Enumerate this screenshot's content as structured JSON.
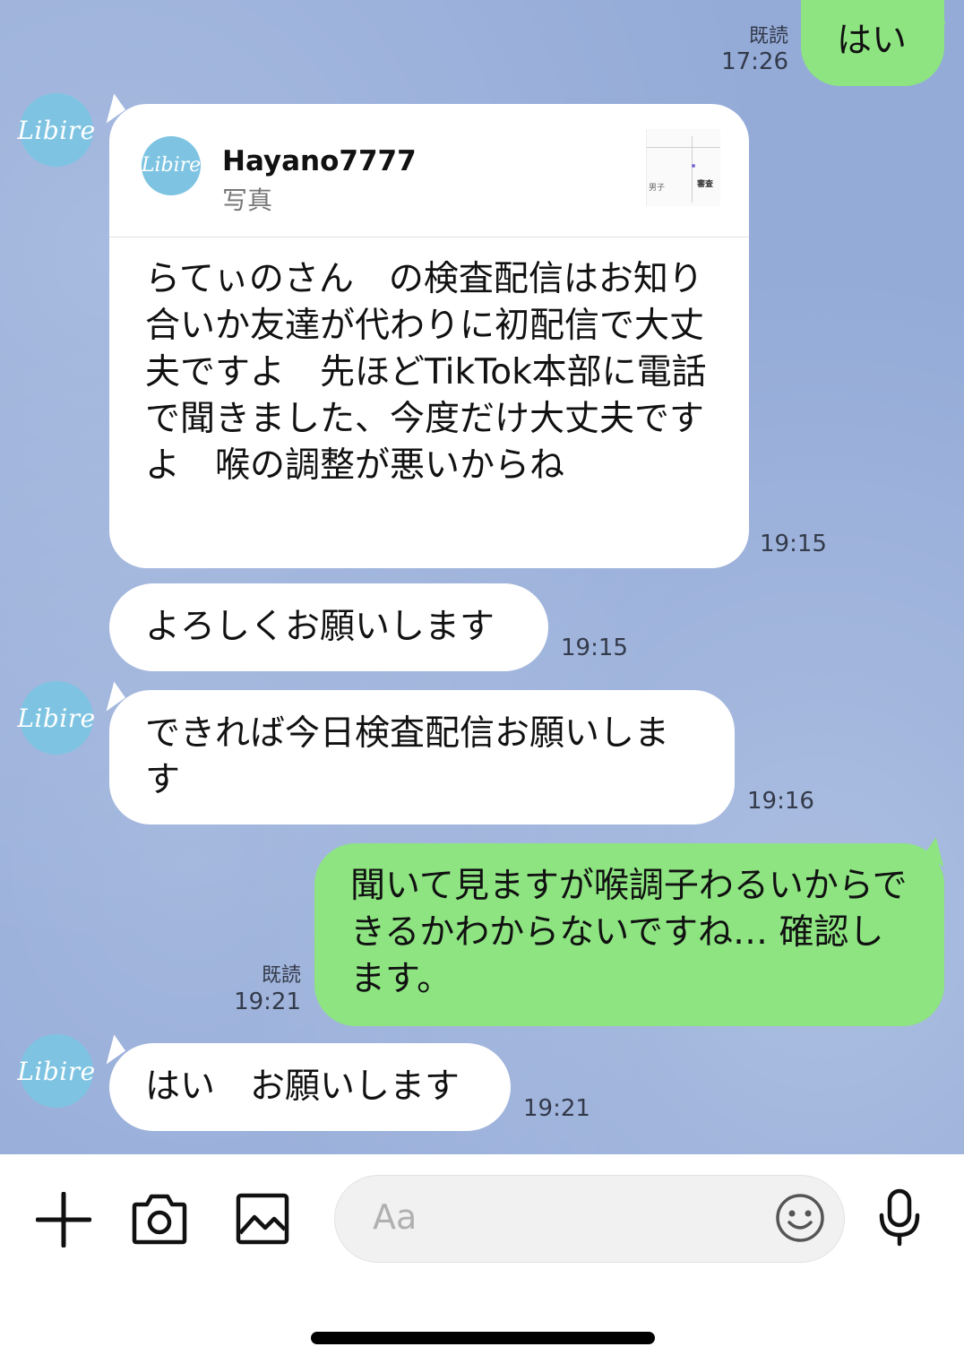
{
  "chat": {
    "sender_avatar_text": "Libire",
    "messages": [
      {
        "side": "out",
        "text": "はい",
        "read": "既読",
        "time": "17:26"
      },
      {
        "side": "in",
        "reply_to": {
          "name": "Hayano7777",
          "type": "写真"
        },
        "text": "らてぃのさん　の検査配信はお知り合いか友達が代わりに初配信で大丈夫ですよ　先ほどTikTok本部に電話で聞きました、今度だけ大丈夫ですよ　喉の調整が悪いからね",
        "time": "19:15"
      },
      {
        "side": "in",
        "text": "よろしくお願いします",
        "time": "19:15"
      },
      {
        "side": "in",
        "text": "できれば今日検査配信お願いします",
        "time": "19:16"
      },
      {
        "side": "out",
        "text": "聞いて見ますが喉調子わるいからできるかわからないですね… 確認します。",
        "read": "既読",
        "time": "19:21"
      },
      {
        "side": "in",
        "text": "はい　お願いします",
        "time": "19:21"
      }
    ],
    "reply_thumb_labels": [
      "男子",
      "審査"
    ]
  },
  "input_bar": {
    "placeholder": "Aa",
    "icons": [
      "plus-icon",
      "camera-icon",
      "image-icon",
      "emoji-icon",
      "microphone-icon"
    ]
  },
  "colors": {
    "background": "#94abd8",
    "outgoing_bubble": "#8de481",
    "incoming_bubble": "#ffffff",
    "avatar": "#7ec4e2"
  }
}
